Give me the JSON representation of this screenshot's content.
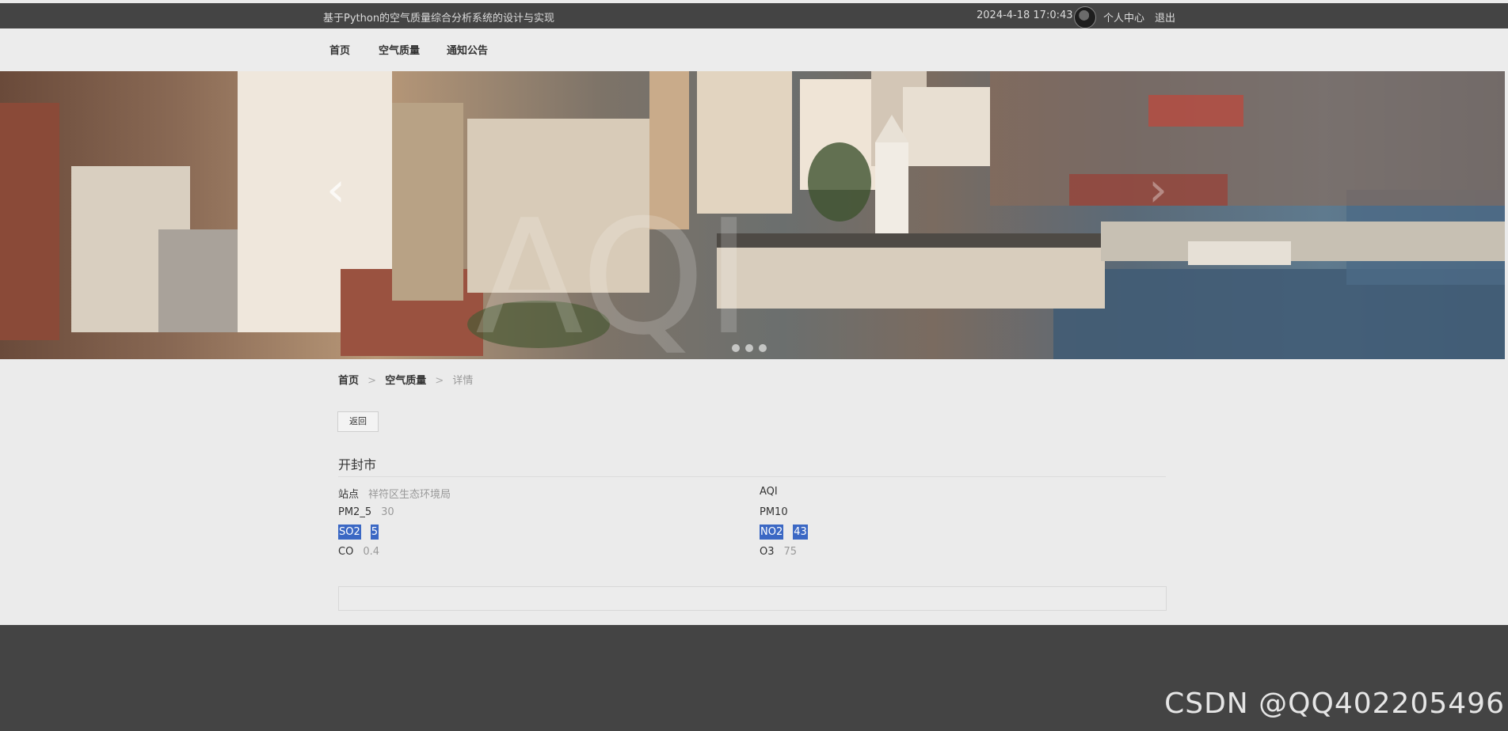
{
  "topbar": {
    "title": "基于Python的空气质量综合分析系统的设计与实现",
    "datetime": "2024-4-18 17:0:43",
    "user_center": "个人中心",
    "logout": "退出"
  },
  "nav": {
    "items": [
      {
        "label": "首页"
      },
      {
        "label": "空气质量"
      },
      {
        "label": "通知公告"
      }
    ]
  },
  "carousel": {
    "dots": 3,
    "prev_icon": "chevron-left-icon",
    "next_icon": "chevron-right-icon"
  },
  "breadcrumb": {
    "home": "首页",
    "section": "空气质量",
    "current": "详情",
    "separator": ">"
  },
  "back_button": "返回",
  "city": "开封市",
  "fields": {
    "station": {
      "label": "站点",
      "value": "祥符区生态环境局"
    },
    "aqi": {
      "label": "AQI",
      "value": ""
    },
    "pm25": {
      "label": "PM2_5",
      "value": "30"
    },
    "pm10": {
      "label": "PM10",
      "value": ""
    },
    "so2": {
      "label": "SO2",
      "value": "5"
    },
    "no2": {
      "label": "NO2",
      "value": "43"
    },
    "co": {
      "label": "CO",
      "value": "0.4"
    },
    "o3": {
      "label": "O3",
      "value": "75"
    }
  },
  "watermark": "CSDN @QQ402205496",
  "colors": {
    "topbar_bg": "#444444",
    "page_bg": "#ebebeb",
    "selection": "#3b68c4",
    "footer_bg": "#444444"
  }
}
